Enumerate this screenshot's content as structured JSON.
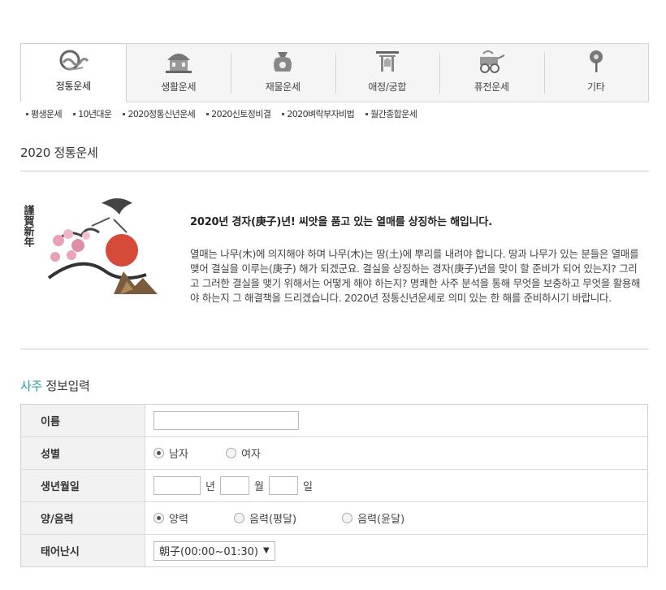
{
  "nav": {
    "tabs": [
      {
        "label": "정통운세",
        "icon": "cloud-icon",
        "active": true
      },
      {
        "label": "생활운세",
        "icon": "house-icon",
        "active": false
      },
      {
        "label": "재물운세",
        "icon": "money-pouch-icon",
        "active": false
      },
      {
        "label": "애정/궁합",
        "icon": "shrine-gate-icon",
        "active": false
      },
      {
        "label": "퓨전운세",
        "icon": "cart-icon",
        "active": false
      },
      {
        "label": "기타",
        "icon": "pin-icon",
        "active": false
      }
    ]
  },
  "subnav": {
    "items": [
      "평생운세",
      "10년대운",
      "2020정통신년운세",
      "2020신토정비결",
      "2020벼락부자비법",
      "월간종합운세"
    ]
  },
  "page": {
    "title": "2020 정통운세"
  },
  "intro": {
    "image_caption": "謹賀新年",
    "heading": "2020년 경자(庚子)년! 씨앗을 품고 있는 열매를 상징하는 해입니다.",
    "body": "열매는 나무(木)에 의지해야 하며 나무(木)는 땅(土)에 뿌리를 내려야 합니다. 땅과 나무가 있는 분들은 열매를 맺어 결실을 이루는(庚子) 해가 되겠군요. 결실을 상징하는 경자(庚子)년을 맞이 할 준비가 되어 있는지? 그리고 그러한 결실을 맺기 위해서는 어떻게 해야 하는지? 명쾌한 사주 분석을 통해 무엇을 보충하고 무엇을 활용해야 하는지 그 해결책을 드리겠습니다. 2020년 정통신년운세로 의미 있는 한 해를 준비하시기 바랍니다."
  },
  "form": {
    "title_accent": "사주",
    "title_rest": " 정보입력",
    "rows": {
      "name": {
        "label": "이름",
        "value": ""
      },
      "gender": {
        "label": "성별",
        "options": [
          "남자",
          "여자"
        ],
        "selected": "남자"
      },
      "birth": {
        "label": "생년월일",
        "year_unit": "년",
        "month_unit": "월",
        "day_unit": "일",
        "year": "",
        "month": "",
        "day": ""
      },
      "calendar": {
        "label": "양/음력",
        "options": [
          "양력",
          "음력(평달)",
          "음력(윤달)"
        ],
        "selected": "양력"
      },
      "birth_time": {
        "label": "태어난시",
        "selected": "朝子(00:00~01:30)"
      }
    }
  },
  "colors": {
    "accent": "#2a9a9a",
    "header_cell": "#f2f2f2",
    "nav_bg": "#f5f5f5"
  }
}
